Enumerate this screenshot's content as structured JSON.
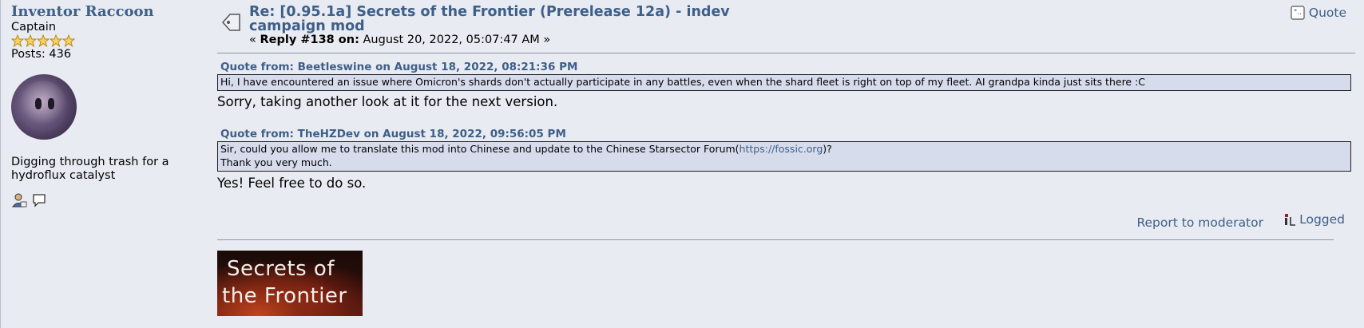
{
  "poster": {
    "name": "Inventor Raccoon",
    "rank": "Captain",
    "stars": 5,
    "posts_label": "Posts: 436",
    "personal_text": "Digging through trash for a hydroflux catalyst"
  },
  "post": {
    "subject": "Re: [0.95.1a] Secrets of the Frontier (Prerelease 12a) - indev campaign mod",
    "reply_prefix": "«",
    "reply_label": "Reply #138 on:",
    "reply_date": "August 20, 2022, 05:07:47 AM",
    "reply_suffix": "»",
    "quote_button": "Quote"
  },
  "quotes": [
    {
      "header": "Quote from: Beetleswine on August 18, 2022, 08:21:36 PM",
      "text": "Hi, I have encountered an issue where Omicron's shards don't actually participate in any battles, even when the shard fleet is right on top of my fleet. AI grandpa kinda just sits there :C",
      "reply": "Sorry, taking another look at it for the next version."
    },
    {
      "header": "Quote from: TheHZDev on August 18, 2022, 09:56:05 PM",
      "text_before_link": "Sir, could you allow me to translate this mod into Chinese and update to the Chinese Starsector Forum(",
      "link": "https://fossic.org",
      "text_after_link": ")?",
      "text_line2": "Thank you very much.",
      "reply": "Yes! Feel free to do so."
    }
  ],
  "footer": {
    "report_label": "Report to moderator",
    "logged_label": "Logged"
  },
  "signature": {
    "line1": "Secrets of",
    "line2": "the Frontier"
  },
  "colors": {
    "link": "#3d5f88",
    "background": "#e9ebf2",
    "quote_bg": "#d7dcec"
  }
}
